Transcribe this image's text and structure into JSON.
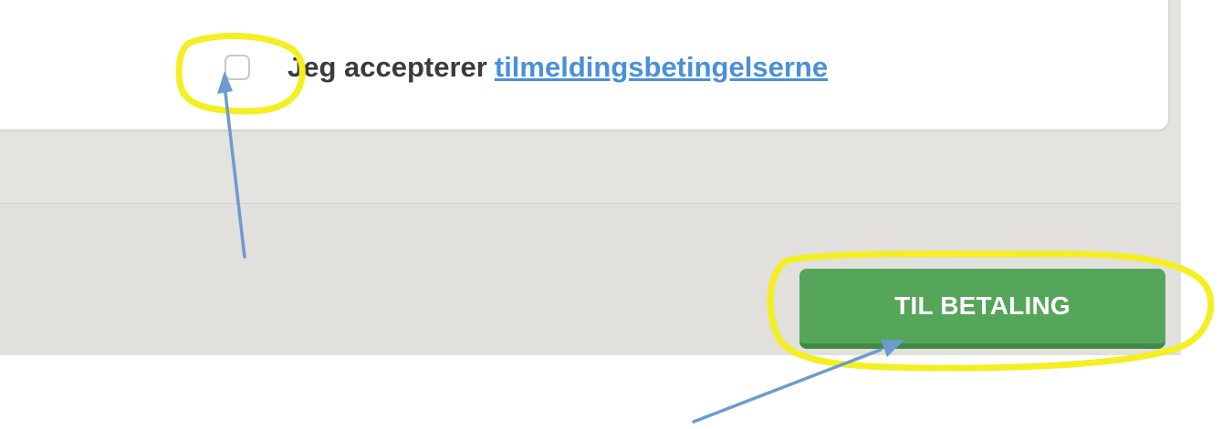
{
  "terms": {
    "text": "Jeg accepterer",
    "link_text": "tilmeldingsbetingelserne"
  },
  "actions": {
    "pay_button_label": "TIL BETALING"
  },
  "theme": {
    "annotation_highlight": "#f4ef22",
    "annotation_arrow": "#6d9bd0",
    "button_green": "#55a65a",
    "link_blue": "#4a90d9"
  }
}
